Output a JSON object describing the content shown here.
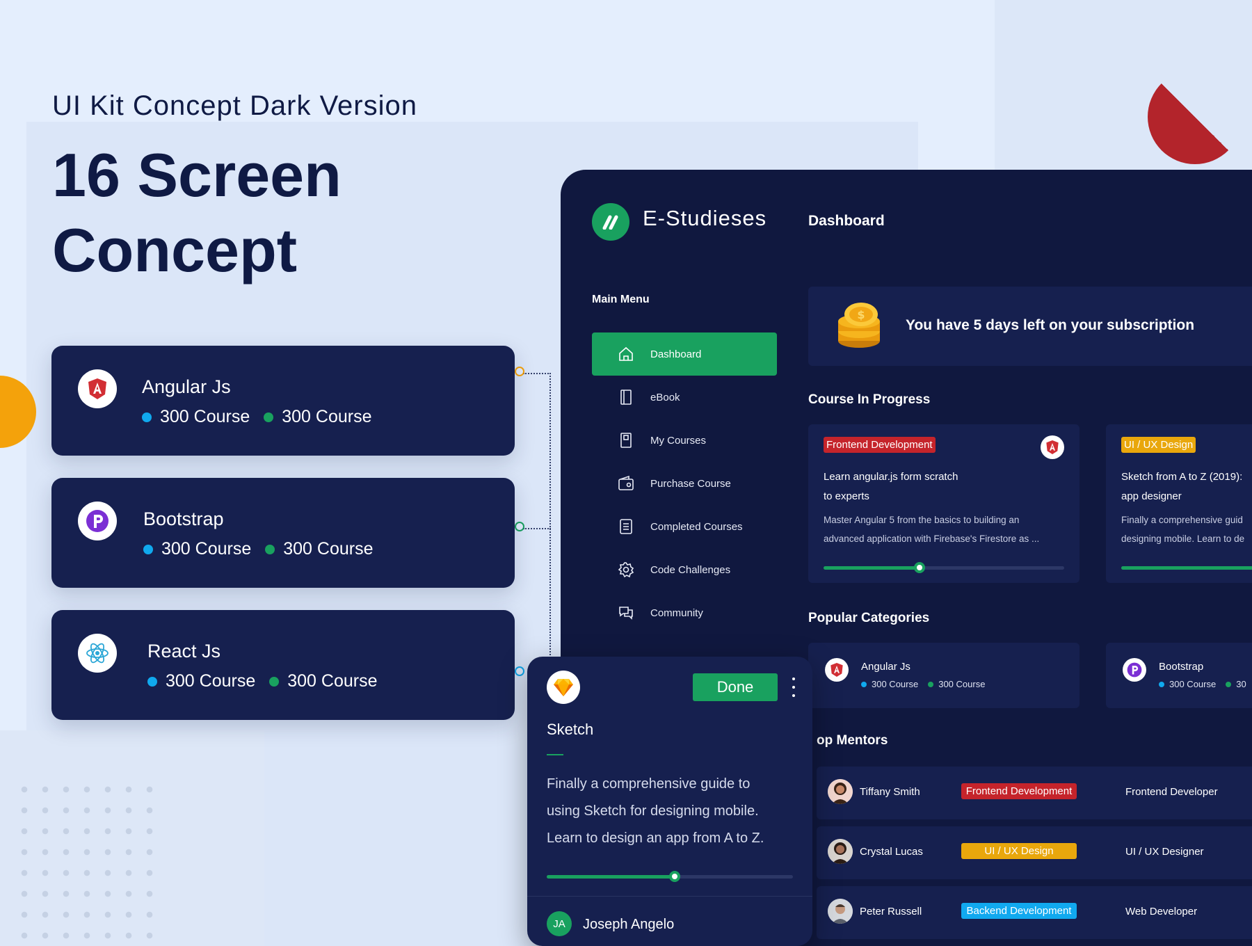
{
  "hero": {
    "subtitle": "UI Kit Concept Dark Version",
    "title": "16 Screen Concept"
  },
  "left_cards": [
    {
      "name": "Angular Js",
      "icon": "angular-icon",
      "stat1": "300 Course",
      "stat2": "300 Course"
    },
    {
      "name": "Bootstrap",
      "icon": "bootstrap-icon",
      "stat1": "300 Course",
      "stat2": "300 Course"
    },
    {
      "name": "React Js",
      "icon": "react-icon",
      "stat1": "300 Course",
      "stat2": "300 Course"
    }
  ],
  "app": {
    "brand": "E-Studieses",
    "page_title": "Dashboard",
    "menu_title": "Main Menu",
    "menu": [
      {
        "label": "Dashboard",
        "icon": "home-icon",
        "active": true
      },
      {
        "label": "eBook",
        "icon": "book-icon"
      },
      {
        "label": "My Courses",
        "icon": "notebook-icon"
      },
      {
        "label": "Purchase Course",
        "icon": "wallet-icon"
      },
      {
        "label": "Completed Courses",
        "icon": "checklist-icon"
      },
      {
        "label": "Code Challenges",
        "icon": "gear-icon"
      },
      {
        "label": "Community",
        "icon": "chat-icon"
      }
    ],
    "subscription": "You have 5 days left on your subscription",
    "course_in_progress": {
      "title": "Course In Progress",
      "cards": [
        {
          "tag": "Frontend Development",
          "title_line1": "Learn angular.js form scratch",
          "title_line2": "to experts",
          "desc_line1": "Master Angular 5 from the basics to building an",
          "desc_line2": "advanced application with Firebase's Firestore as ...",
          "progress": 0.4
        },
        {
          "tag": "UI / UX Design",
          "title_line1": "Sketch from A to Z (2019):",
          "title_line2": "app designer",
          "desc_line1": "Finally a comprehensive guid",
          "desc_line2": "designing mobile. Learn to de",
          "progress": 1.0
        }
      ]
    },
    "popular_categories": {
      "title": "Popular Categories",
      "items": [
        {
          "name": "Angular Js",
          "stat1": "300 Course",
          "stat2": "300 Course"
        },
        {
          "name": "Bootstrap",
          "stat1": "300 Course",
          "stat2": "30"
        }
      ]
    },
    "top_mentors": {
      "title": "op Mentors",
      "rows": [
        {
          "name": "Tiffany Smith",
          "tag": "Frontend Development",
          "role": "Frontend Developer"
        },
        {
          "name": "Crystal Lucas",
          "tag": "UI / UX Design",
          "role": "UI / UX Designer"
        },
        {
          "name": "Peter Russell",
          "tag": "Backend Development",
          "role": "Web Developer"
        }
      ]
    }
  },
  "sketch_card": {
    "done_label": "Done",
    "title": "Sketch",
    "desc_line1": "Finally a comprehensive guide to",
    "desc_line2": "using Sketch for designing mobile.",
    "desc_line3": "Learn to design an app from A to Z.",
    "progress": 0.52,
    "user_initials": "JA",
    "user_name": "Joseph Angelo"
  },
  "colors": {
    "navy": "#16204f",
    "dark_bg": "#10183f",
    "green": "#19a15f",
    "red": "#c5242b",
    "yellow": "#e9a70c",
    "blue": "#11a9ef"
  }
}
